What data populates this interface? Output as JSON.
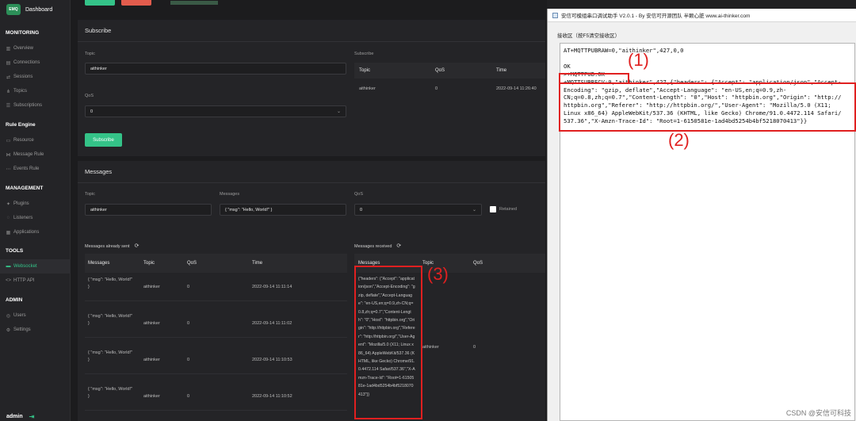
{
  "sidebar": {
    "brand": {
      "logo": "EMQ",
      "title": "Dashboard"
    },
    "groups": [
      {
        "title": "MONITORING",
        "items": [
          {
            "icon": "chart-icon",
            "glyph": "▥",
            "label": "Overview"
          },
          {
            "icon": "server-icon",
            "glyph": "▤",
            "label": "Connections"
          },
          {
            "icon": "sessions-icon",
            "glyph": "⇄",
            "label": "Sessions"
          },
          {
            "icon": "topics-icon",
            "glyph": "⋔",
            "label": "Topics"
          },
          {
            "icon": "subscriptions-icon",
            "glyph": "☰",
            "label": "Subscriptions"
          }
        ]
      },
      {
        "title": "Rule Engine",
        "items": [
          {
            "icon": "resource-icon",
            "glyph": "▭",
            "label": "Resource"
          },
          {
            "icon": "message-rule-icon",
            "glyph": "⋈",
            "label": "Message Rule"
          },
          {
            "icon": "events-rule-icon",
            "glyph": "⋯",
            "label": "Events Rule"
          }
        ]
      },
      {
        "title": "MANAGEMENT",
        "items": [
          {
            "icon": "plugins-icon",
            "glyph": "✦",
            "label": "Plugins"
          },
          {
            "icon": "listeners-icon",
            "glyph": "◌",
            "label": "Listeners"
          },
          {
            "icon": "applications-icon",
            "glyph": "▦",
            "label": "Applications"
          }
        ]
      },
      {
        "title": "TOOLS",
        "items": [
          {
            "icon": "websocket-icon",
            "glyph": "▬",
            "label": "Websocket",
            "active": true
          },
          {
            "icon": "http-api-icon",
            "glyph": "<>",
            "label": "HTTP API"
          }
        ]
      },
      {
        "title": "ADMIN",
        "items": [
          {
            "icon": "users-icon",
            "glyph": "◎",
            "label": "Users"
          },
          {
            "icon": "settings-icon",
            "glyph": "⚙",
            "label": "Settings"
          }
        ]
      }
    ],
    "footer": {
      "user": "admin",
      "logout_glyph": "⇥"
    }
  },
  "subscribe": {
    "title": "Subscribe",
    "topic_label": "Topic",
    "topic_value": "aithinker",
    "qos_label": "QoS",
    "qos_value": "0",
    "button": "Subscribe",
    "list_title": "Subscribe",
    "columns": [
      "Topic",
      "QoS",
      "Time"
    ],
    "rows": [
      {
        "topic": "aithinker",
        "qos": "0",
        "time": "2022-09-14 11:26:40"
      }
    ]
  },
  "messages": {
    "title": "Messages",
    "topic_label": "Topic",
    "topic_value": "aithinker",
    "message_label": "Messages",
    "message_value": "{ \"msg\": \"Hello, World!\" }",
    "qos_label": "QoS",
    "qos_value": "0",
    "retained_label": "Retained",
    "sent_title": "Messages already sent",
    "received_title": "Messages received",
    "sent_columns": [
      "Messages",
      "Topic",
      "QoS",
      "Time"
    ],
    "received_columns": [
      "Messages",
      "Topic",
      "QoS"
    ],
    "sent_rows": [
      {
        "msg1": "{ \"msg\": \"Hello, World!\"",
        "msg2": "}",
        "topic": "aithinker",
        "qos": "0",
        "time": "2022-09-14 11:11:14"
      },
      {
        "msg1": "{ \"msg\": \"Hello, World!\"",
        "msg2": "}",
        "topic": "aithinker",
        "qos": "0",
        "time": "2022-09-14 11:11:02"
      },
      {
        "msg1": "{ \"msg\": \"Hello, World!\"",
        "msg2": "}",
        "topic": "aithinker",
        "qos": "0",
        "time": "2022-09-14 11:10:53"
      },
      {
        "msg1": "{ \"msg\": \"Hello, World!\"",
        "msg2": "}",
        "topic": "aithinker",
        "qos": "0",
        "time": "2022-09-14 11:10:52"
      }
    ],
    "received_row": {
      "message": "{\"headers\": {\"Accept\": \"application/json\",\"Accept-Encoding\": \"gzip, deflate\",\"Accept-Language\": \"en-US,en;q=0.9,zh-CN;q=0.8,zh;q=0.7\",\"Content-Length\": \"0\",\"Host\": \"httpbin.org\",\"Origin\": \"http://httpbin.org\",\"Referer\": \"http://httpbin.org/\",\"User-Agent\": \"Mozilla/5.0 (X11; Linux x86_64) AppleWebKit/537.36 (KHTML, like Gecko) Chrome/91.0.4472.114 Safari/537.36\",\"X-Amzn-Trace-Id\": \"Root=1-6150581e-1ad4bd5254b4bf5218070413\"}}",
      "topic": "aithinker",
      "qos": "0"
    }
  },
  "tool": {
    "title": "安信可模组串口调试助手 V2.0.1 - By 安信可开源团队 半颗心脏 www.ai-thinker.com",
    "group_label": "接收区（按F5清空接收区）",
    "lines": [
      "AT+MQTTPUBRAW=0,\"aithinker\",427,0,0",
      "",
      "OK",
      ">+MQTTPUB:OK",
      "+MQTTSUBRECV:0,\"aithinker\",427,{\"headers\": {\"Accept\": \"application/json\",\"Accept-",
      "Encoding\": \"gzip, deflate\",\"Accept-Language\": \"en-US,en;q=0.9,zh-",
      "CN;q=0.8,zh;q=0.7\",\"Content-Length\": \"0\",\"Host\": \"httpbin.org\",\"Origin\": \"http://",
      "httpbin.org\",\"Referer\": \"http://httpbin.org/\",\"User-Agent\": \"Mozilla/5.0 (X11;",
      "Linux x86_64) AppleWebKit/537.36 (KHTML, like Gecko) Chrome/91.0.4472.114 Safari/",
      "537.36\",\"X-Amzn-Trace-Id\": \"Root=1-6150581e-1ad4bd5254b4bf5218070413\"}}"
    ]
  },
  "annotations": {
    "a1": "(1)",
    "a2": "(2)",
    "a3": "(3)"
  },
  "watermark": "CSDN @安信可科技",
  "colors": {
    "accent_green": "#34c388",
    "annotation_red": "#e02020"
  }
}
